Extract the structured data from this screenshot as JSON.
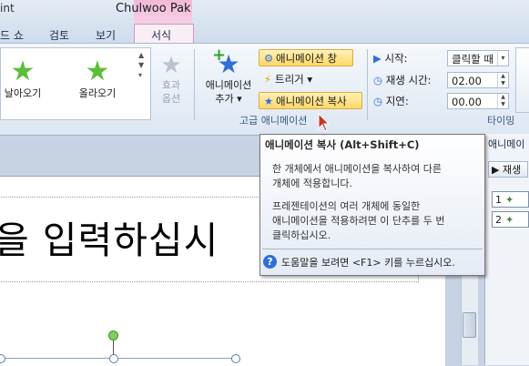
{
  "window": {
    "title_fragment": "int",
    "user": "Chulwoo Pak"
  },
  "tabs": [
    {
      "label": "드 쇼"
    },
    {
      "label": "검토"
    },
    {
      "label": "보기"
    },
    {
      "label": "서식"
    }
  ],
  "gallery": {
    "items": [
      {
        "label": "날아오기",
        "icon": "fly-in-star-icon"
      },
      {
        "label": "올라오기",
        "icon": "rise-up-star-icon"
      }
    ]
  },
  "effect_options": {
    "line1": "효과",
    "line2": "옵션"
  },
  "advanced": {
    "add_animation": {
      "line1": "애니메이션",
      "line2": "추가"
    },
    "pane_button": "애니메이션 창",
    "trigger_button": "트리거",
    "painter_button": "애니메이션 복사",
    "group_label": "고급 애니메이션"
  },
  "timing": {
    "start_label": "시작:",
    "start_value": "클릭할 때",
    "duration_label": "재생 시간:",
    "duration_value": "02.00",
    "delay_label": "지연:",
    "delay_value": "00.00",
    "group_label": "타이밍"
  },
  "tooltip": {
    "title": "애니메이션 복사 (Alt+Shift+C)",
    "para1_line1": "한 개체에서 애니메이션을 복사하여 다른",
    "para1_line2": "개체에 적용합니다.",
    "para2_line1": "프레젠테이션의 여러 개체에 동일한",
    "para2_line2": "애니메이션을 적용하려면 이 단추를 두 번",
    "para2_line3": "클릭하십시오.",
    "help": "도움말을 보려면 <F1> 키를 누르십시오."
  },
  "slide": {
    "text": "을 입력하십시"
  },
  "pane": {
    "title": "애니메이",
    "play": "재생",
    "items": [
      {
        "num": "1"
      },
      {
        "num": "2"
      }
    ]
  },
  "colors": {
    "accent_blue": "#2f6fd6",
    "star_green": "#5bbe3b",
    "context_tab": "#f3b8d8",
    "highlight": "#ffd76a"
  }
}
